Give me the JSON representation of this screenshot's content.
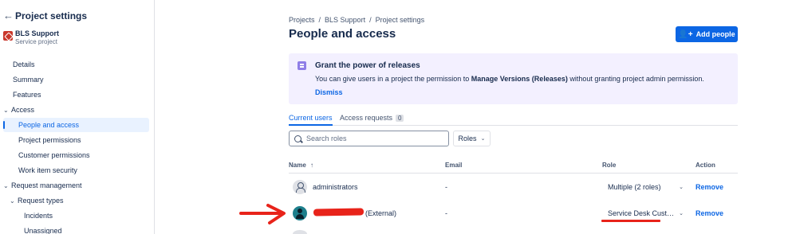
{
  "sidebar": {
    "back_icon": "arrow-left-icon",
    "title": "Project settings",
    "project": {
      "name": "BLS Support",
      "type": "Service project",
      "icon": "project-avatar-icon"
    },
    "items": [
      {
        "label": "Details"
      },
      {
        "label": "Summary"
      },
      {
        "label": "Features"
      },
      {
        "label": "Access",
        "expandable": true
      },
      {
        "label": "People and access",
        "active": true
      },
      {
        "label": "Project permissions"
      },
      {
        "label": "Customer permissions"
      },
      {
        "label": "Work item security"
      },
      {
        "label": "Request management",
        "expandable": true
      },
      {
        "label": "Request types",
        "expandable": true
      },
      {
        "label": "Incidents"
      },
      {
        "label": "Unassigned"
      }
    ]
  },
  "breadcrumb": [
    "Projects",
    "BLS Support",
    "Project settings"
  ],
  "breadcrumb_sep": "/",
  "page_title": "People and access",
  "add_people_label": "Add people",
  "banner": {
    "title": "Grant the power of releases",
    "message_before": "You can give users in a project the permission to ",
    "message_bold": "Manage Versions (Releases)",
    "message_after": " without granting project admin permission.",
    "dismiss": "Dismiss"
  },
  "tabs": [
    {
      "label": "Current users",
      "selected": true
    },
    {
      "label": "Access requests",
      "count": "0"
    }
  ],
  "search": {
    "placeholder": "Search roles"
  },
  "roles_filter_label": "Roles",
  "table": {
    "headers": {
      "name": "Name",
      "email": "Email",
      "role": "Role",
      "action": "Action"
    },
    "sort_icon": "arrow-up-icon",
    "rows": [
      {
        "name": "administrators",
        "email": "-",
        "role": "Multiple (2 roles)",
        "action": "Remove"
      },
      {
        "name": "(External)",
        "email": "-",
        "role": "Service Desk Cust…",
        "action": "Remove"
      }
    ]
  },
  "colors": {
    "primary": "#0c66e4",
    "banner_bg": "#f3f0ff",
    "annotation_red": "#e8231a"
  }
}
